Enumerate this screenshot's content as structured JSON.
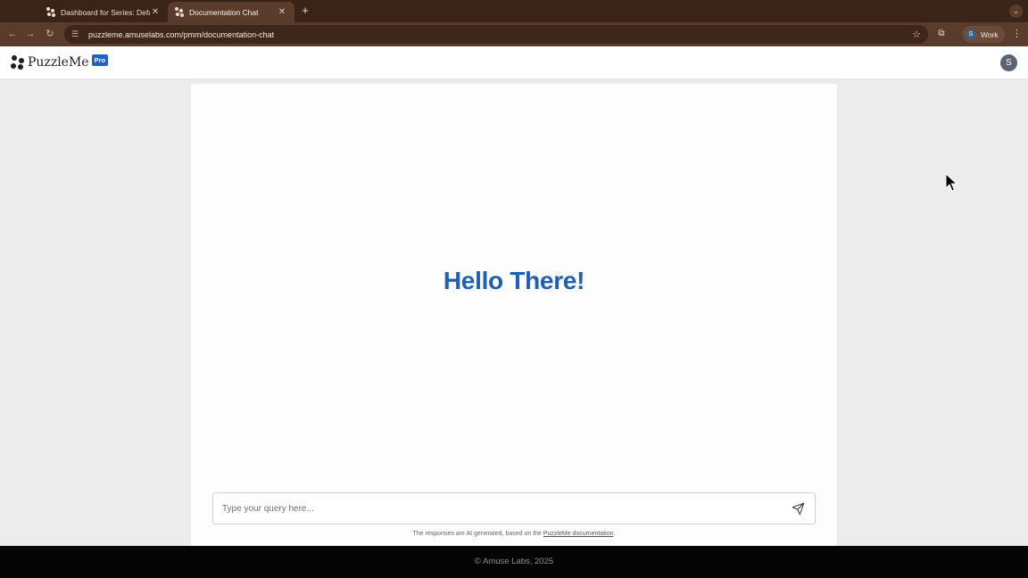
{
  "browser": {
    "tabs": [
      {
        "title": "Dashboard for Series: Default",
        "active": false
      },
      {
        "title": "Documentation Chat",
        "active": true
      }
    ],
    "new_tab_label": "+",
    "url": "puzzleme.amuselabs.com/pmm/documentation-chat",
    "profile": {
      "initial": "S",
      "label": "Work"
    }
  },
  "header": {
    "logo_text": "PuzzleMe",
    "badge": "Pro",
    "user_initial": "S"
  },
  "chat": {
    "greeting": "Hello There!",
    "input_placeholder": "Type your query here...",
    "input_value": "",
    "disclaimer_prefix": "The responses are AI generated, based on the ",
    "disclaimer_link": "PuzzleMe documentation",
    "disclaimer_suffix": "."
  },
  "footer": {
    "copyright": "© Amuse Labs, 2025"
  },
  "colors": {
    "greeting": "#1f5fb4",
    "badge": "#1f63c6",
    "tab_strip": "#3a2418",
    "toolbar": "#5a3c2c",
    "footer": "#050505"
  }
}
